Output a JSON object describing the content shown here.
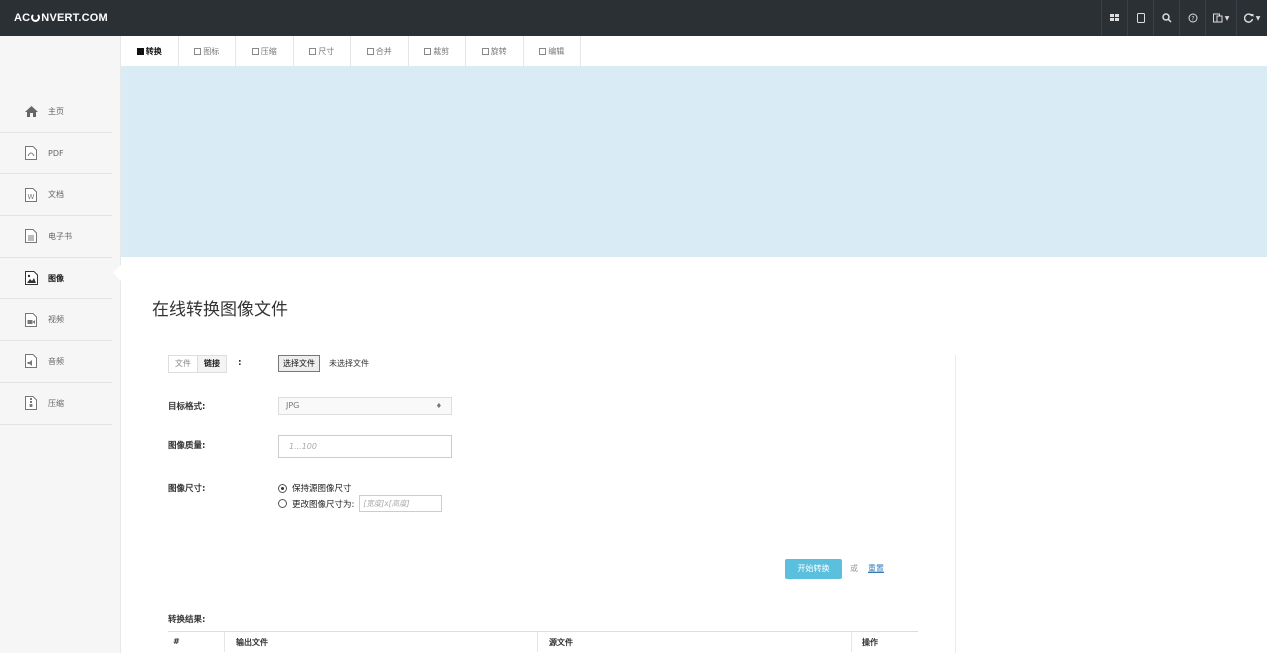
{
  "brand": {
    "prefix": "AC",
    "suffix": "NVERT.COM"
  },
  "topnav": {
    "icons": [
      "grid-icon",
      "mobile-icon",
      "search-icon",
      "help-icon",
      "language-icon",
      "refresh-icon"
    ]
  },
  "tabs": [
    {
      "label": "转换",
      "active": true
    },
    {
      "label": "图标",
      "active": false
    },
    {
      "label": "压缩",
      "active": false
    },
    {
      "label": "尺寸",
      "active": false
    },
    {
      "label": "合并",
      "active": false
    },
    {
      "label": "裁剪",
      "active": false
    },
    {
      "label": "旋转",
      "active": false
    },
    {
      "label": "编辑",
      "active": false
    }
  ],
  "sidebar": {
    "items": [
      {
        "label": "主页",
        "icon": "home-icon"
      },
      {
        "label": "PDF",
        "icon": "pdf-file-icon"
      },
      {
        "label": "文档",
        "icon": "word-file-icon"
      },
      {
        "label": "电子书",
        "icon": "ebook-file-icon"
      },
      {
        "label": "图像",
        "icon": "image-file-icon",
        "active": true
      },
      {
        "label": "视频",
        "icon": "video-file-icon"
      },
      {
        "label": "音频",
        "icon": "audio-file-icon"
      },
      {
        "label": "压缩",
        "icon": "archive-file-icon"
      }
    ]
  },
  "main": {
    "title": "在线转换图像文件",
    "source": {
      "tab_file": "文件",
      "tab_link": "链接",
      "colon": ":",
      "choose_button": "选择文件",
      "no_file_text": "未选择文件"
    },
    "target_format": {
      "label": "目标格式:",
      "value": "JPG",
      "arrow": "♦"
    },
    "quality": {
      "label": "图像质量:",
      "placeholder": "1...100"
    },
    "size": {
      "label": "图像尺寸:",
      "option_keep": "保持源图像尺寸",
      "option_change": "更改图像尺寸为:",
      "size_placeholder": "[宽度]x[高度]"
    },
    "actions": {
      "start": "开始转换",
      "or": "或",
      "reset": "重置"
    },
    "results": {
      "label": "转换结果:",
      "columns": [
        "#",
        "输出文件",
        "源文件",
        "操作"
      ]
    }
  }
}
